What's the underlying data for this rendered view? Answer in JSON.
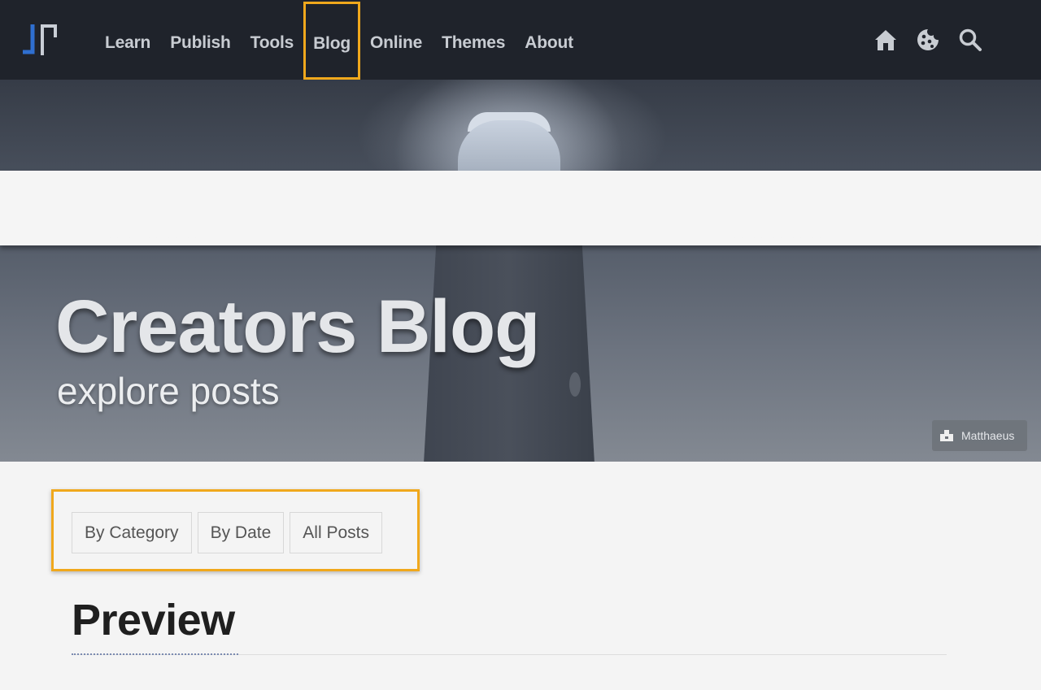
{
  "navbar": {
    "logo_icon": "jt-logo-icon",
    "items": [
      {
        "label": "Learn"
      },
      {
        "label": "Publish"
      },
      {
        "label": "Tools"
      },
      {
        "label": "Blog",
        "highlighted": true
      },
      {
        "label": "Online"
      },
      {
        "label": "Themes"
      },
      {
        "label": "About"
      }
    ],
    "icons": [
      "home-icon",
      "cookie-icon",
      "search-icon"
    ],
    "highlight_color": "#f0a81c"
  },
  "hero": {
    "title": "Creators Blog",
    "subtitle": "explore posts",
    "photo_credit": "Matthaeus"
  },
  "filters": {
    "buttons": [
      {
        "label": "By Category"
      },
      {
        "label": "By Date"
      },
      {
        "label": "All Posts"
      }
    ]
  },
  "preview": {
    "heading": "Preview"
  },
  "colors": {
    "navbar_bg": "#1f232b",
    "accent": "#f0a81c",
    "page_bg": "#f4f4f4"
  }
}
